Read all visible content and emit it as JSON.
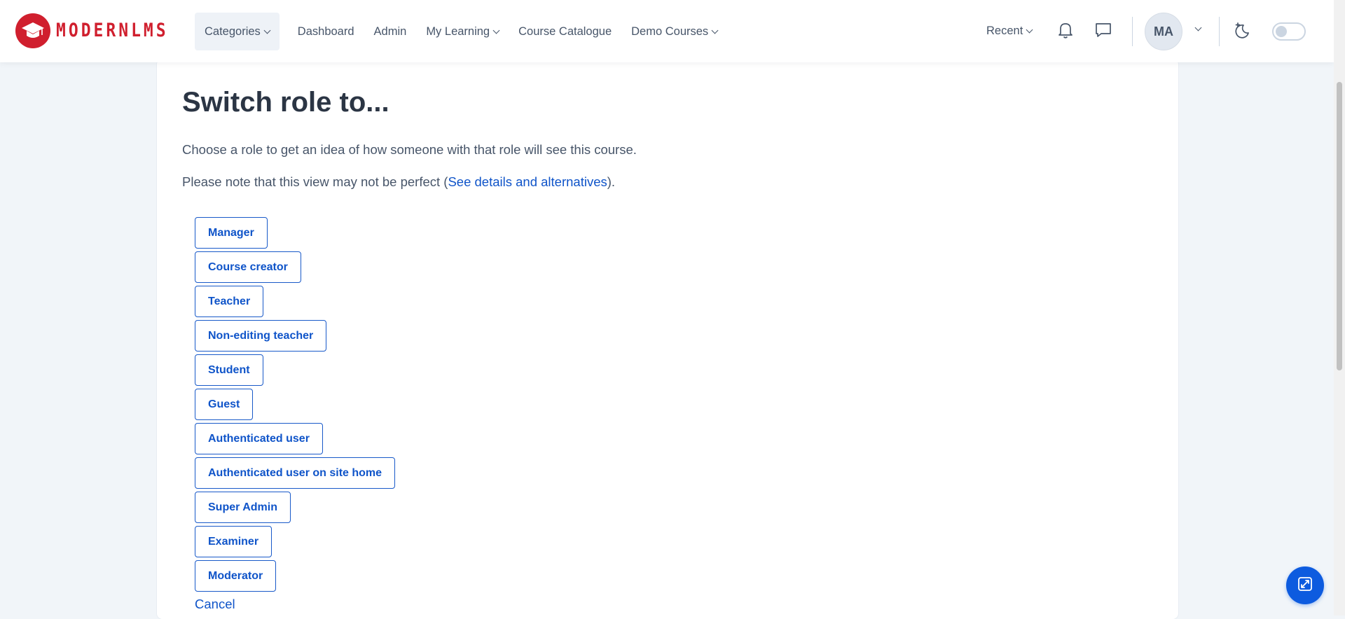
{
  "brand": {
    "name": "MODERNLMS"
  },
  "nav": {
    "items": [
      {
        "label": "Categories",
        "dropdown": true,
        "active": true
      },
      {
        "label": "Dashboard",
        "dropdown": false
      },
      {
        "label": "Admin",
        "dropdown": false
      },
      {
        "label": "My Learning",
        "dropdown": true
      },
      {
        "label": "Course Catalogue",
        "dropdown": false
      },
      {
        "label": "Demo Courses",
        "dropdown": true
      }
    ],
    "recent_label": "Recent",
    "user_initials": "MA",
    "icons": [
      "bell-icon",
      "chat-icon",
      "dark-mode-icon",
      "chevron-down-icon"
    ],
    "dark_mode_enabled": false
  },
  "main": {
    "title": "Switch role to...",
    "intro": "Choose a role to get an idea of how someone with that role will see this course.",
    "note_prefix": "Please note that this view may not be perfect (",
    "note_link": "See details and alternatives",
    "note_suffix": ").",
    "roles": [
      "Manager",
      "Course creator",
      "Teacher",
      "Non-editing teacher",
      "Student",
      "Guest",
      "Authenticated user",
      "Authenticated user on site home",
      "Super Admin",
      "Examiner",
      "Moderator"
    ],
    "cancel_label": "Cancel"
  },
  "colors": {
    "brand": "#d01f2e",
    "link": "#0f54c9",
    "fab": "#0d5bdf",
    "page_bg": "#f1f5f9"
  }
}
